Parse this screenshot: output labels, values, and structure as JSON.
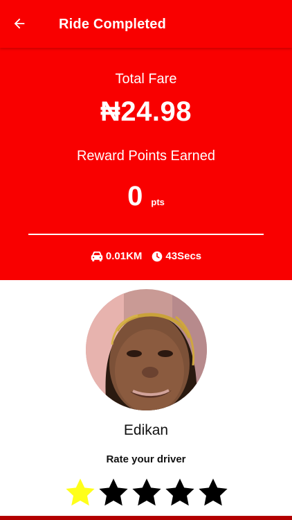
{
  "appbar": {
    "title": "Ride Completed",
    "back_icon": "arrow-left-icon"
  },
  "summary": {
    "fare_label": "Total Fare",
    "fare_value": "₦24.98",
    "reward_label": "Reward Points Earned",
    "points_value": "0",
    "points_unit": "pts",
    "distance": "0.01KM",
    "duration": "43Secs",
    "distance_icon": "car-icon",
    "duration_icon": "clock-icon"
  },
  "driver": {
    "name": "Edikan",
    "rate_label": "Rate your driver",
    "rating": 1,
    "max_rating": 5
  },
  "colors": {
    "primary": "#f90000",
    "star_filled": "#ffff1a",
    "star_empty": "#000000",
    "bottom_bar": "#b30000"
  }
}
